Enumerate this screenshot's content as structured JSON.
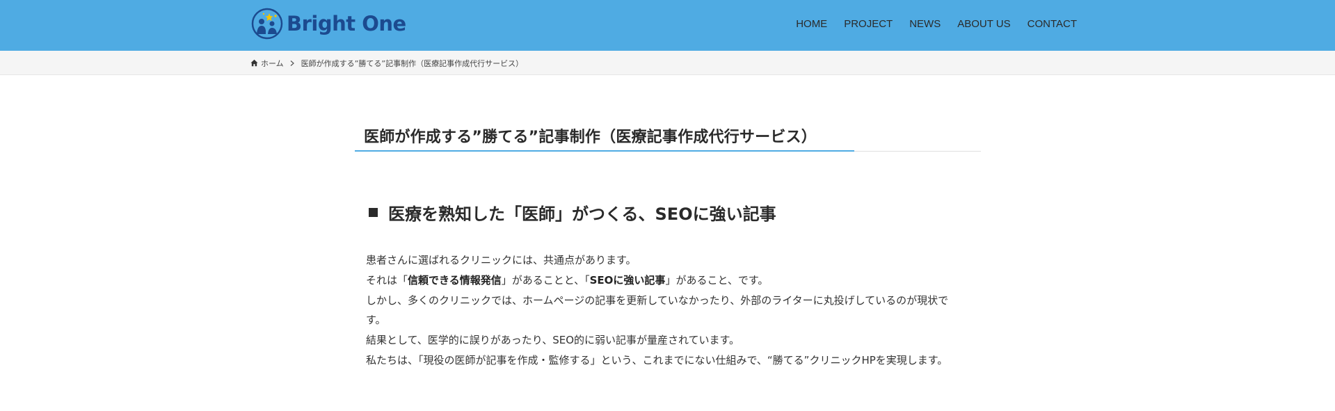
{
  "header": {
    "logo_text": "Bright One",
    "brand_colors": {
      "header_bg": "#4fabe3",
      "logo_navy": "#1c4a8f",
      "logo_star": "#f5c400"
    },
    "nav": [
      {
        "label": "HOME"
      },
      {
        "label": "PROJECT"
      },
      {
        "label": "NEWS"
      },
      {
        "label": "ABOUT US"
      },
      {
        "label": "CONTACT"
      }
    ]
  },
  "breadcrumb": {
    "home_icon": "home-icon",
    "home_label": "ホーム",
    "separator_icon": "chevron-right-icon",
    "current": "医師が作成する”勝てる”記事制作（医療記事作成代行サービス）"
  },
  "page": {
    "title": "医師が作成する”勝てる”記事制作（医療記事作成代行サービス）",
    "accent_color": "#4fabe3",
    "section": {
      "heading_icon": "square-icon",
      "heading": "医療を熟知した「医師」がつくる、SEOに強い記事",
      "paragraphs": {
        "p1": "患者さんに選ばれるクリニックには、共通点があります。",
        "p2": {
          "a": "それは「",
          "b": "信頼できる情報発信",
          "c": "」があることと、「",
          "d": "SEOに強い記事",
          "e": "」があること、です。"
        },
        "p3": "しかし、多くのクリニックでは、ホームページの記事を更新していなかったり、外部のライターに丸投げしているのが現状です。",
        "p4": "結果として、医学的に誤りがあったり、SEO的に弱い記事が量産されています。",
        "p5": "私たちは、「現役の医師が記事を作成・監修する」という、これまでにない仕組みで、“勝てる”クリニックHPを実現します。"
      }
    }
  }
}
